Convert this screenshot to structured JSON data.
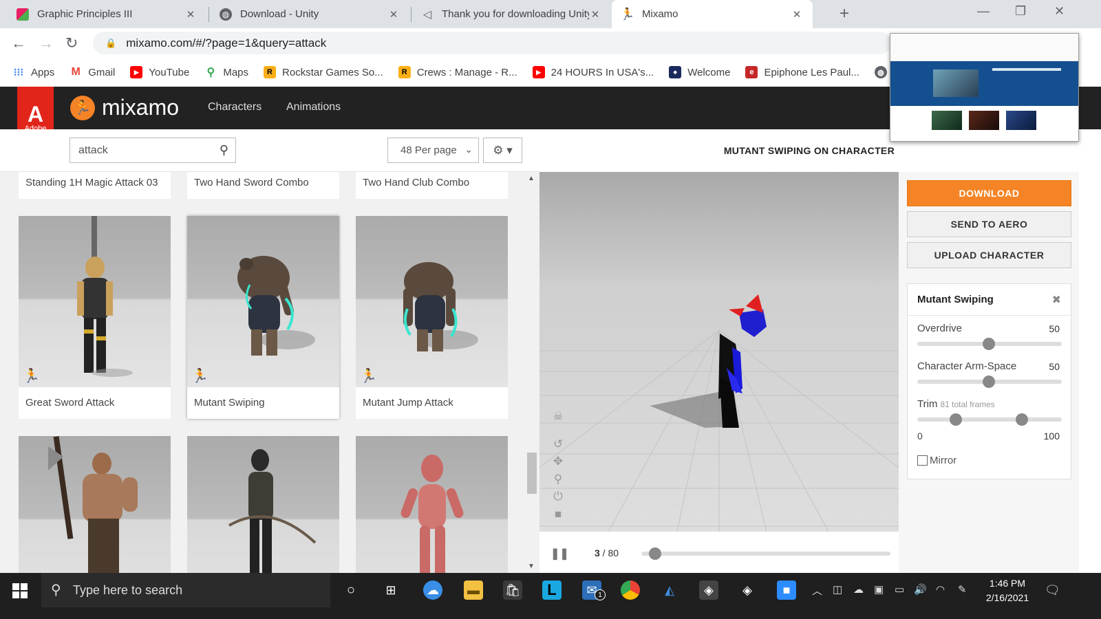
{
  "browser": {
    "tabs": [
      {
        "label": "Graphic Principles III",
        "close": "✕"
      },
      {
        "label": "Download - Unity",
        "close": "✕"
      },
      {
        "label": "Thank you for downloading Unity",
        "close": "✕"
      },
      {
        "label": "Mixamo",
        "close": "✕"
      }
    ],
    "new_tab": "+",
    "url": "mixamo.com/#/?page=1&query=attack",
    "bookmarks": [
      "Apps",
      "Gmail",
      "YouTube",
      "Maps",
      "Rockstar Games So...",
      "Crews : Manage - R...",
      "24 HOURS In USA's...",
      "Welcome",
      "Epiphone Les Paul..."
    ]
  },
  "header": {
    "adobe_label": "Adobe",
    "brand": "mixamo",
    "nav": [
      "Characters",
      "Animations"
    ]
  },
  "toolbar": {
    "search_value": "attack",
    "per_page": "48 Per page"
  },
  "results": {
    "top_row": [
      "Standing 1H Magic Attack 03",
      "Two Hand Sword Combo",
      "Two Hand Club Combo"
    ],
    "middle_row": [
      "Great Sword Attack",
      "Mutant Swiping",
      "Mutant Jump Attack"
    ],
    "selected": "Mutant Swiping"
  },
  "viewer": {
    "title": "MUTANT SWIPING ON CHARACTER",
    "current_frame": "3",
    "frame_sep": " / 80",
    "playhead": 0.03
  },
  "actions": {
    "download": "DOWNLOAD",
    "send_to_aero": "SEND TO AERO",
    "upload_character": "UPLOAD CHARACTER"
  },
  "settings": {
    "title": "Mutant Swiping",
    "overdrive_label": "Overdrive",
    "overdrive_value": "50",
    "arm_space_label": "Character Arm-Space",
    "arm_space_value": "50",
    "trim_label": "Trim",
    "trim_note": "81 total frames",
    "trim_min": "0",
    "trim_max": "100",
    "mirror_label": "Mirror"
  },
  "taskbar": {
    "search_placeholder": "Type here to search",
    "time": "1:46 PM",
    "date": "2/16/2021",
    "mail_badge": "1"
  },
  "colors": {
    "accent": "#f58426",
    "adobe_red": "#e1251b",
    "header_bg": "#222222"
  }
}
